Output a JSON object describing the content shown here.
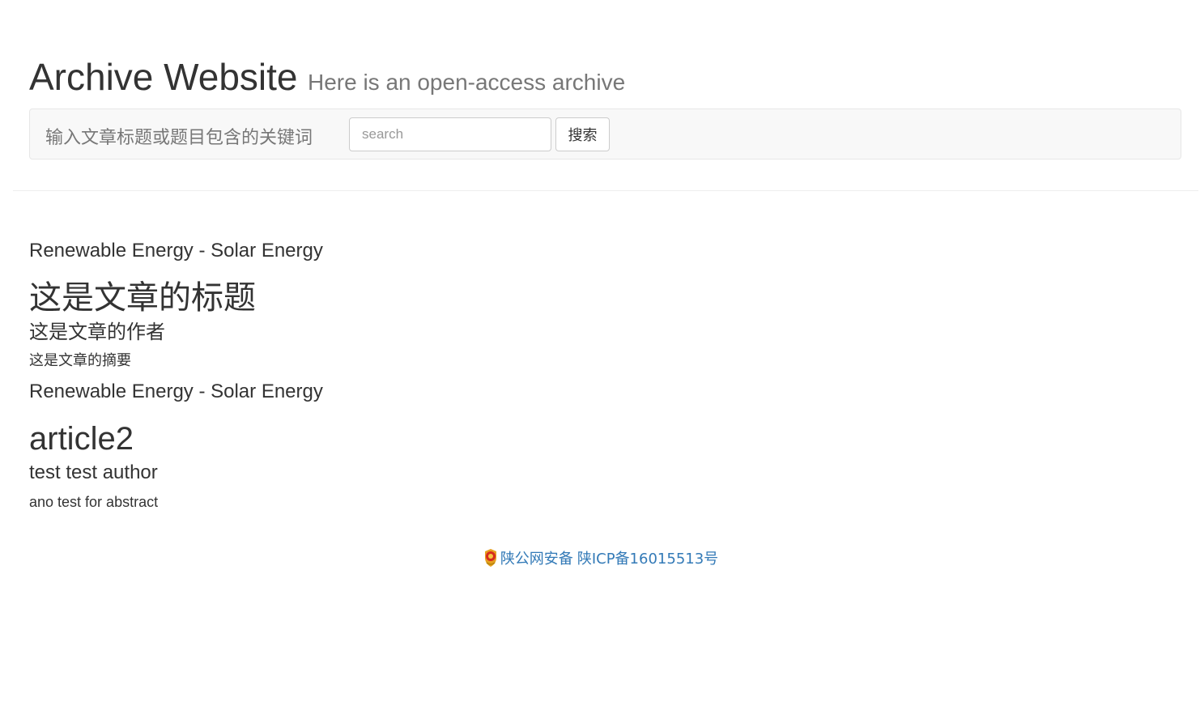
{
  "header": {
    "title": "Archive Website",
    "subtitle": "Here is an open-access archive"
  },
  "search": {
    "label": "输入文章标题或题目包含的关键词",
    "placeholder": "search",
    "value": "",
    "button_label": "搜索"
  },
  "articles": [
    {
      "category": "Renewable Energy - Solar Energy",
      "title": "这是文章的标题",
      "author": "这是文章的作者",
      "abstract": "这是文章的摘要"
    },
    {
      "category": "Renewable Energy - Solar Energy",
      "title": "article2",
      "author": "test test author",
      "abstract": "ano test for abstract"
    }
  ],
  "footer": {
    "icon": "police-badge-icon",
    "police_record": "陕公网安备",
    "icp_record": "陕ICP备16015513号",
    "link_color": "#337ab7"
  }
}
